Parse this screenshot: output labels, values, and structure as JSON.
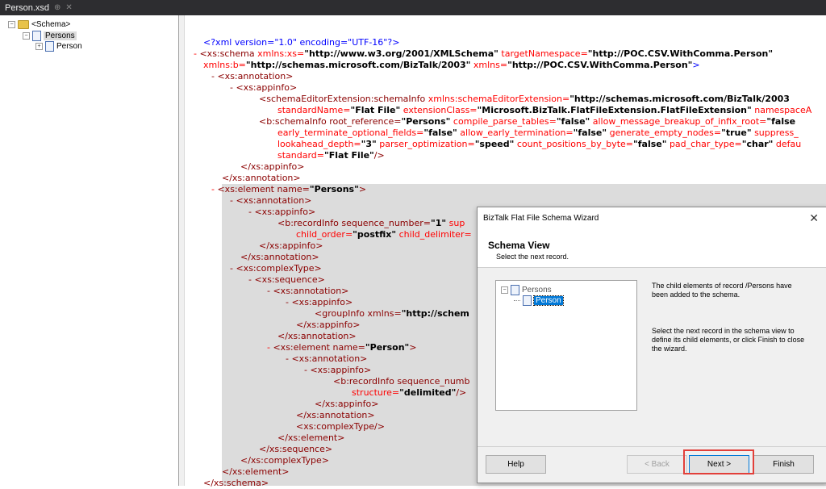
{
  "tab": {
    "title": "Person.xsd",
    "pin": "⊕",
    "close": "✕"
  },
  "tree": {
    "root": "<Schema>",
    "persons": "Persons",
    "person": "Person"
  },
  "code": {
    "l1": "<?xml version=\"1.0\" encoding=\"UTF-16\"?>",
    "l2a": "- ",
    "l2b": "<xs:schema ",
    "l2c": "xmlns:xs=",
    "l2d": "\"http://www.w3.org/2001/XMLSchema\"",
    "l2e": " targetNamespace=",
    "l2f": "\"http://POC.CSV.WithComma.Person\"",
    "l3a": "xmlns:b=",
    "l3b": "\"http://schemas.microsoft.com/BizTalk/2003\"",
    "l3c": " xmlns=",
    "l3d": "\"http://POC.CSV.WithComma.Person\"",
    "l3e": ">",
    "l4": "- <xs:annotation>",
    "l5": "- <xs:appinfo>",
    "l6a": "<schemaEditorExtension:schemaInfo ",
    "l6b": "xmlns:schemaEditorExtension=",
    "l6c": "\"http://schemas.microsoft.com/BizTalk/2003",
    "l7a": "standardName=",
    "l7b": "\"Flat File\"",
    "l7c": " extensionClass=",
    "l7d": "\"Microsoft.BizTalk.FlatFileExtension.FlatFileExtension\"",
    "l7e": " namespaceA",
    "l8a": "<b:schemaInfo root_reference=",
    "l8b": "\"Persons\"",
    "l8c": " compile_parse_tables=",
    "l8d": "\"false\"",
    "l8e": " allow_message_breakup_of_infix_root=",
    "l8f": "\"false",
    "l9a": "early_terminate_optional_fields=",
    "l9b": "\"false\"",
    "l9c": " allow_early_termination=",
    "l9d": "\"false\"",
    "l9e": " generate_empty_nodes=",
    "l9f": "\"true\"",
    "l9g": " suppress_",
    "l10a": "lookahead_depth=",
    "l10b": "\"3\"",
    "l10c": " parser_optimization=",
    "l10d": "\"speed\"",
    "l10e": " count_positions_by_byte=",
    "l10f": "\"false\"",
    "l10g": " pad_char_type=",
    "l10h": "\"char\"",
    "l10i": " defau",
    "l11a": "standard=",
    "l11b": "\"Flat File\"",
    "l11c": "/>",
    "l12": "</xs:appinfo>",
    "l13": "</xs:annotation>",
    "l14a": "- ",
    "l14b": "<xs:element name=",
    "l14c": "\"Persons\"",
    "l14d": ">",
    "l15": "- <xs:annotation>",
    "l16": "- <xs:appinfo>",
    "l17a": "<b:recordInfo sequence_number=",
    "l17b": "\"1\"",
    "l17c": " sup",
    "l18a": "child_order=",
    "l18b": "\"postfix\"",
    "l18c": " child_delimiter=",
    "l19": "</xs:appinfo>",
    "l20": "</xs:annotation>",
    "l21": "- <xs:complexType>",
    "l22": "- <xs:sequence>",
    "l23": "- <xs:annotation>",
    "l24": "- <xs:appinfo>",
    "l25a": "<groupInfo xmlns=",
    "l25b": "\"http://schem",
    "l26": "</xs:appinfo>",
    "l27": "</xs:annotation>",
    "l28a": "- ",
    "l28b": "<xs:element name=",
    "l28c": "\"Person\"",
    "l28d": ">",
    "l29": "- <xs:annotation>",
    "l30": "- <xs:appinfo>",
    "l31": "<b:recordInfo sequence_numb",
    "l32a": "structure=",
    "l32b": "\"delimited\"",
    "l32c": "/>",
    "l33": "</xs:appinfo>",
    "l34": "</xs:annotation>",
    "l35": "<xs:complexType/>",
    "l36": "</xs:element>",
    "l37": "</xs:sequence>",
    "l38": "</xs:complexType>",
    "l39": "</xs:element>",
    "l40": "</xs:schema>"
  },
  "dialog": {
    "title": "BizTalk Flat File Schema Wizard",
    "close": "✕",
    "heading": "Schema View",
    "subheading": "Select the next record.",
    "tree_root": "Persons",
    "tree_child": "Person",
    "info1": "The child elements of record /Persons have been added to the schema.",
    "info2": "Select the next record in the schema view to define its child elements, or click Finish to close the wizard.",
    "help": "Help",
    "back": "< Back",
    "next": "Next >",
    "finish": "Finish"
  },
  "colors": {
    "tag": "#8b0000",
    "attr_name": "#ff0000",
    "attr_value": "#0000ff",
    "highlight": "#e2403a"
  }
}
